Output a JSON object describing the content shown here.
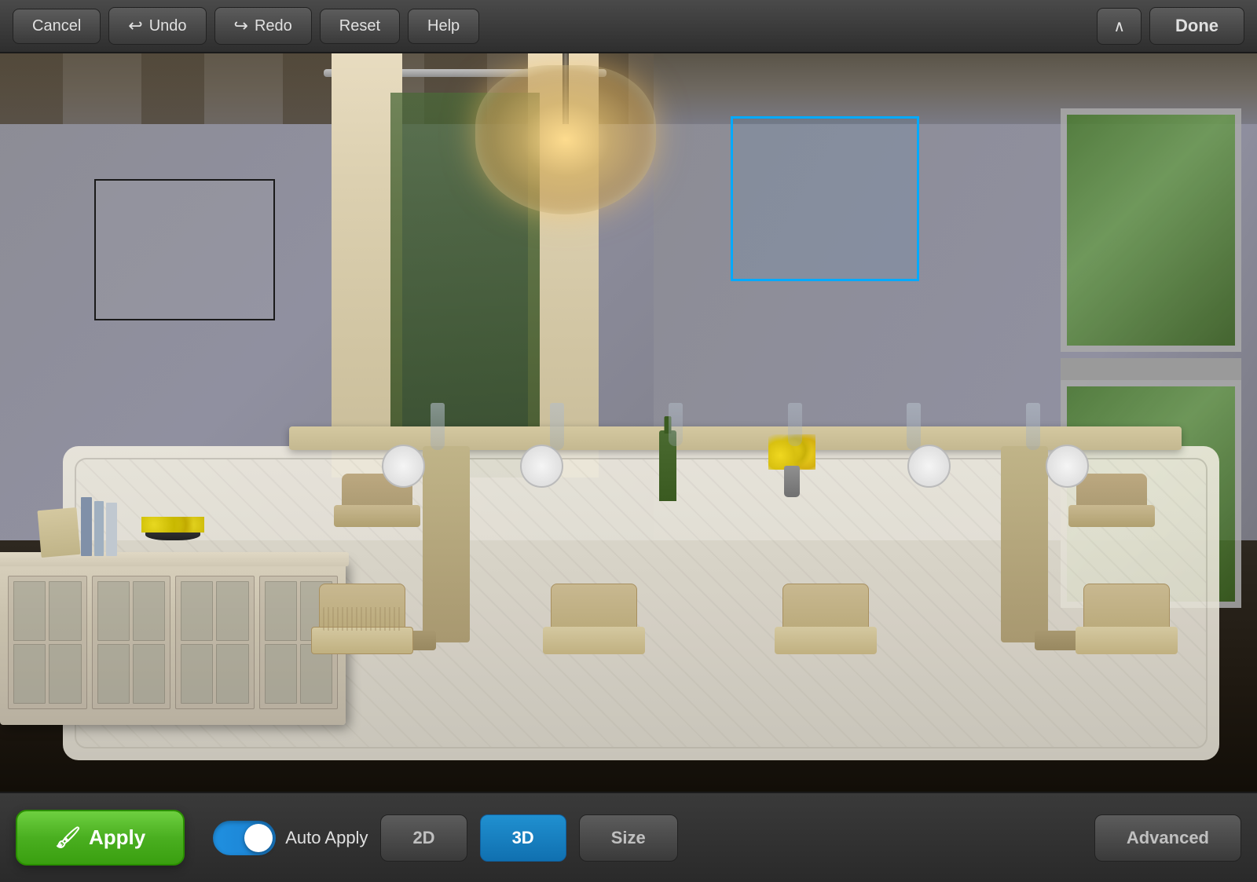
{
  "toolbar": {
    "cancel_label": "Cancel",
    "undo_label": "Undo",
    "redo_label": "Redo",
    "reset_label": "Reset",
    "help_label": "Help",
    "done_label": "Done"
  },
  "bottom_bar": {
    "apply_label": "Apply",
    "auto_apply_label": "Auto Apply",
    "view_2d_label": "2D",
    "view_3d_label": "3D",
    "size_label": "Size",
    "advanced_label": "Advanced",
    "toggle_state": "on"
  },
  "scene": {
    "selection_black": "selected art/paint area",
    "selection_blue": "selected window area"
  }
}
